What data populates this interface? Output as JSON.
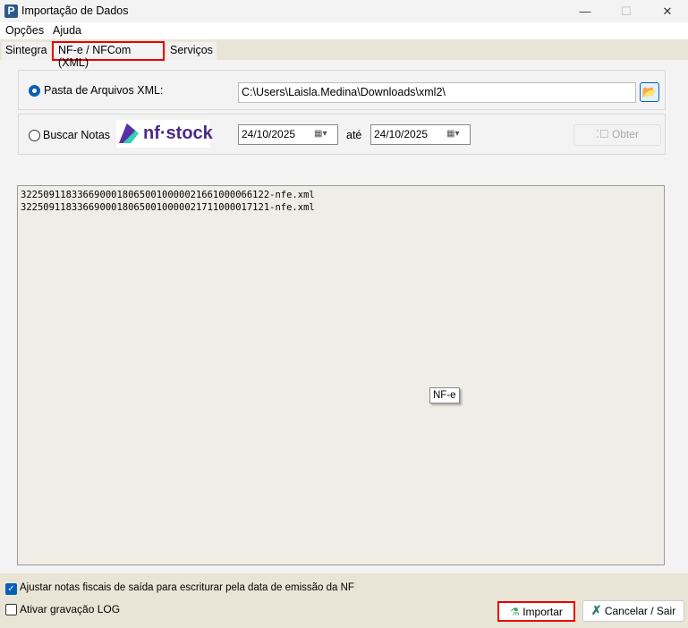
{
  "window": {
    "title": "Importação de Dados",
    "app_icon": "P",
    "minimize": "—",
    "maximize": "☐",
    "close": "✕"
  },
  "menu": [
    "Opções",
    "Ajuda"
  ],
  "tabs": [
    "Sintegra",
    "NF-e / NFCom (XML)",
    "Serviços"
  ],
  "folder": {
    "label": "Pasta de Arquivos XML:",
    "value": "C:\\Users\\Laisla.Medina\\Downloads\\xml2\\"
  },
  "search": {
    "label": "Buscar Notas",
    "logo": "nf·stock",
    "date_from": "24/10/2025",
    "until": "até",
    "date_to": "24/10/2025",
    "obter": "Obter"
  },
  "files": [
    "32250911833669000180650010000021661000066122-nfe.xml",
    "32250911833669000180650010000021711000017121-nfe.xml"
  ],
  "tooltip": "NF-e",
  "options": {
    "adjust": "Ajustar notas fiscais de saída para escriturar pela data de emissão da NF",
    "log": "Ativar gravação LOG"
  },
  "buttons": {
    "import": "Importar",
    "cancel": "Cancelar / Sair"
  }
}
